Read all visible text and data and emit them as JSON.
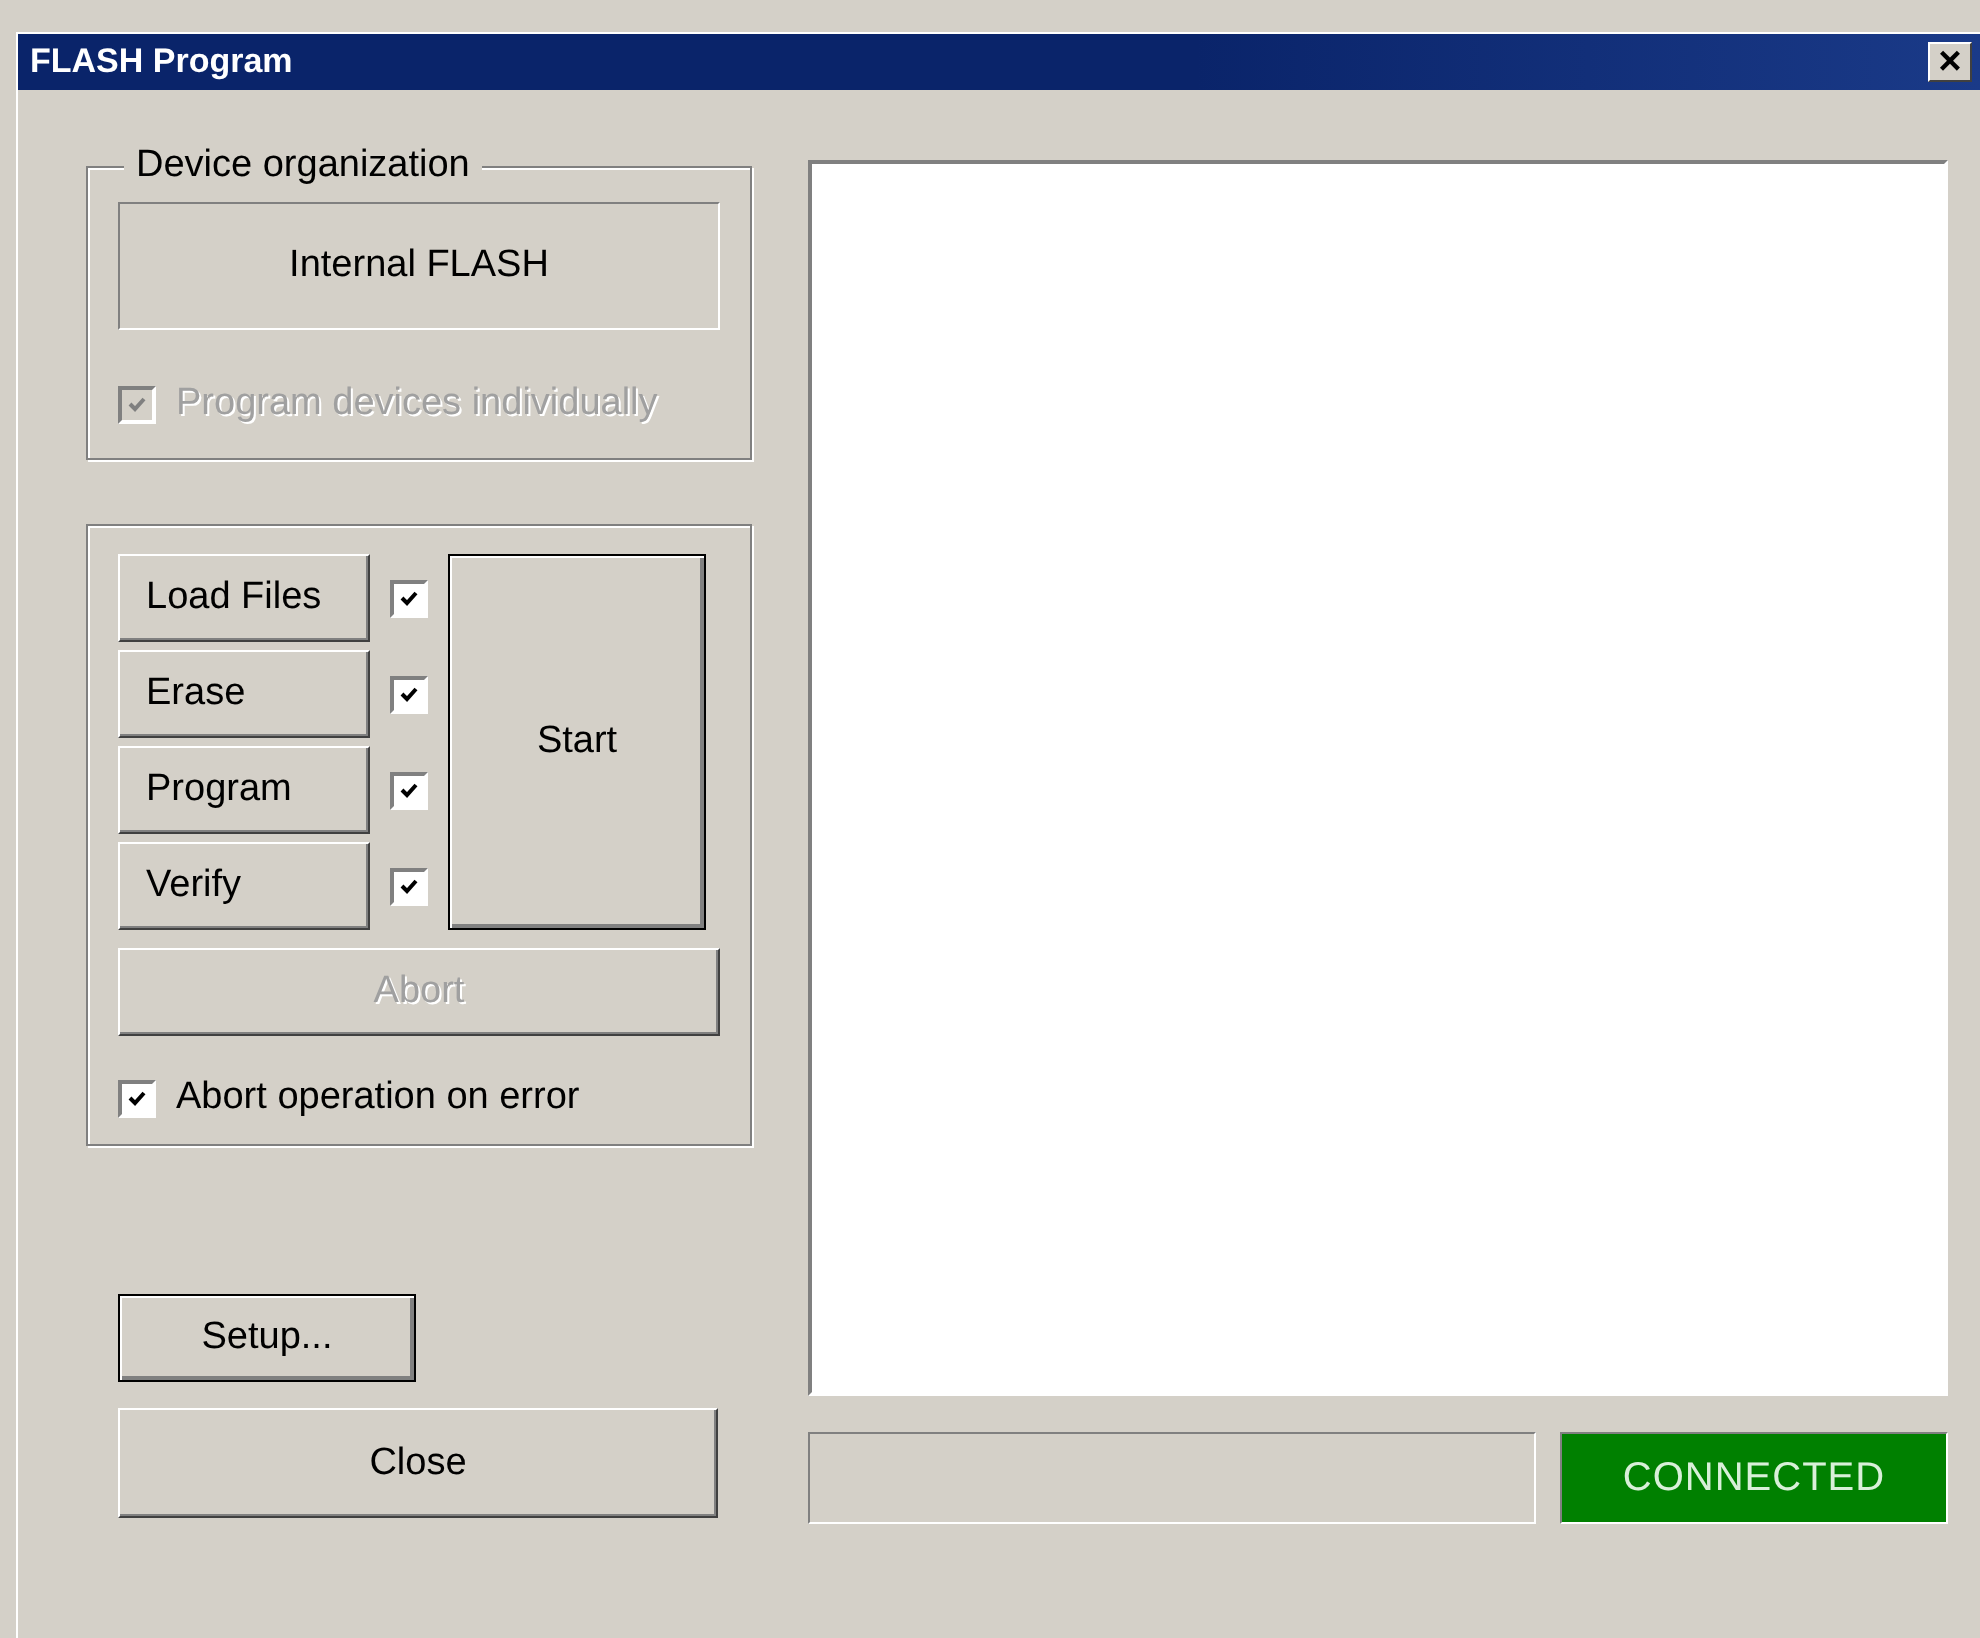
{
  "window": {
    "title": "FLASH Program",
    "close_glyph": "×"
  },
  "device_organization": {
    "title": "Device organization",
    "device": "Internal FLASH",
    "individual": {
      "label": "Program devices individually",
      "checked": true,
      "disabled": true
    }
  },
  "operations": [
    {
      "label": "Load Files",
      "checked": true
    },
    {
      "label": "Erase",
      "checked": true
    },
    {
      "label": "Program",
      "checked": true
    },
    {
      "label": "Verify",
      "checked": true
    }
  ],
  "start_button": "Start",
  "abort_button": {
    "label": "Abort",
    "disabled": true
  },
  "abort_on_error": {
    "label": "Abort operation on error",
    "checked": true
  },
  "setup_button": "Setup...",
  "close_button": "Close",
  "progress": {
    "level": 0
  },
  "status": {
    "label": "CONNECTED",
    "connected": true
  }
}
